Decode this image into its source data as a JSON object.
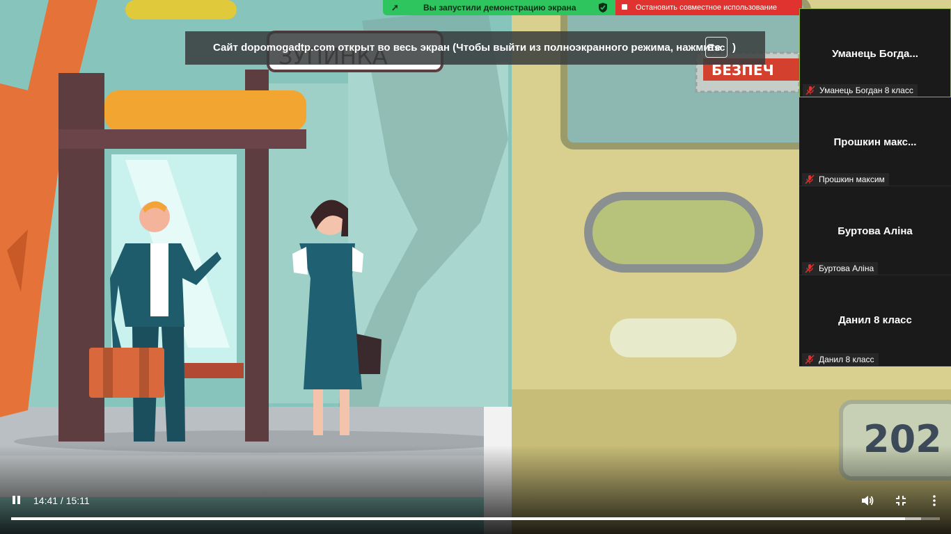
{
  "share_bar": {
    "status_label": "Вы запустили демонстрацию экрана",
    "stop_label": "Остановить совместное использование",
    "status_color": "#2ec55e",
    "stop_color": "#e0322e"
  },
  "fullscreen_notice": {
    "message": "Сайт dopomogadtp.com открыт во весь экран (Чтобы выйти из полноэкранного режима, нажмите",
    "key": "Esc",
    "closing": ")"
  },
  "scene": {
    "sign_text": "ЗУПИНКА",
    "bus_sign_text": "БЕЗПЕЧ",
    "plate_text": "202"
  },
  "participants": [
    {
      "display": "Уманець  Богда...",
      "label": "Уманець Богдан 8 класс",
      "muted": true,
      "active": true
    },
    {
      "display": "Прошкин  макс...",
      "label": "Прошкин максим",
      "muted": true,
      "active": false
    },
    {
      "display": "Буртова Аліна",
      "label": "Буртова Аліна",
      "muted": true,
      "active": false
    },
    {
      "display": "Данил 8 класс",
      "label": "Данил 8 класс",
      "muted": true,
      "active": false
    }
  ],
  "player": {
    "time": "14:41 / 15:11",
    "progress": 0.9623,
    "buffered": 0.98,
    "state": "playing",
    "icons": [
      "pause-icon",
      "volume-icon",
      "exit-fullscreen-icon",
      "more-options-icon"
    ]
  }
}
